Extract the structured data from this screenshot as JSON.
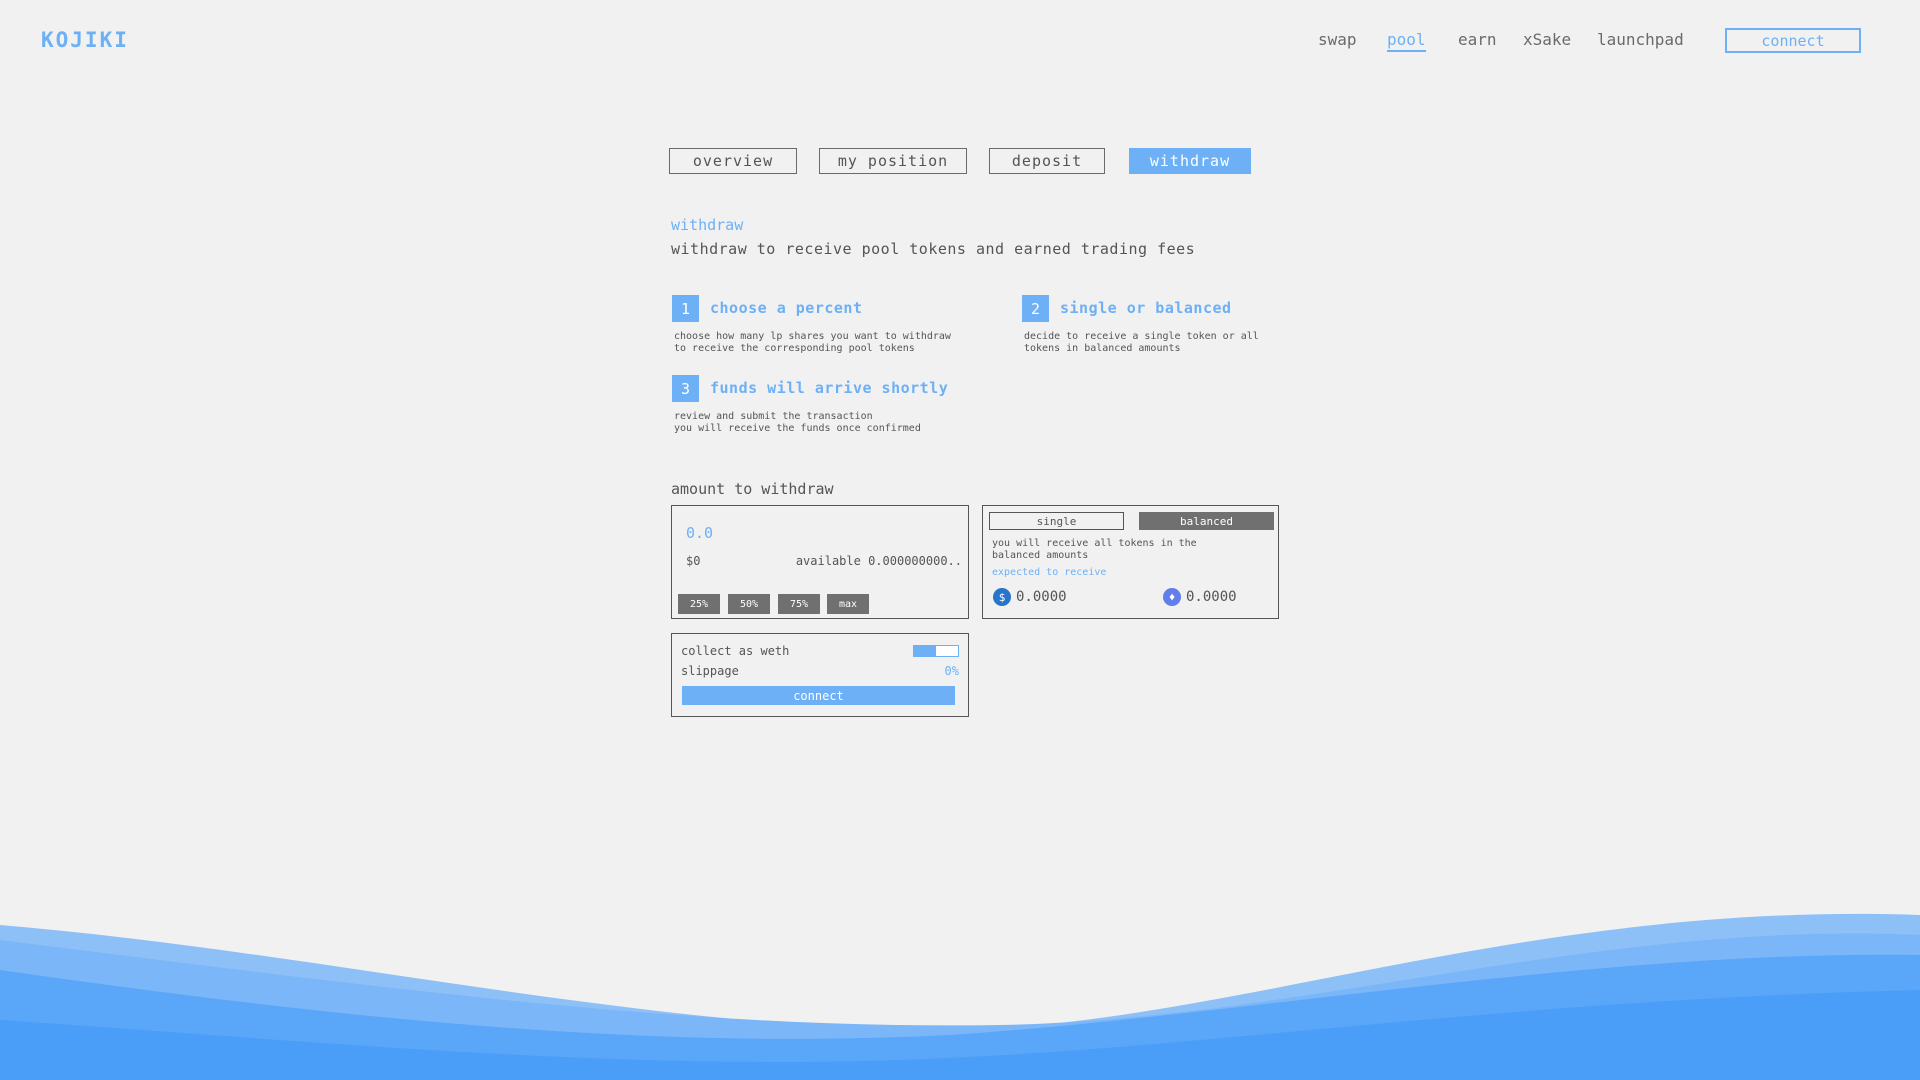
{
  "header": {
    "logo": "KOJIKI",
    "nav": [
      {
        "label": "swap",
        "active": false
      },
      {
        "label": "pool",
        "active": true
      },
      {
        "label": "earn",
        "active": false
      },
      {
        "label": "xSake",
        "active": false
      },
      {
        "label": "launchpad",
        "active": false
      }
    ],
    "connect_label": "connect"
  },
  "tabs": [
    {
      "label": "overview",
      "active": false
    },
    {
      "label": "my position",
      "active": false
    },
    {
      "label": "deposit",
      "active": false
    },
    {
      "label": "withdraw",
      "active": true
    }
  ],
  "intro": {
    "title": "withdraw",
    "subtitle": "withdraw to receive pool tokens and earned trading fees"
  },
  "steps": [
    {
      "number": "1",
      "title": "choose a percent",
      "desc": "choose how many lp shares you want to withdraw\nto receive the corresponding pool tokens"
    },
    {
      "number": "2",
      "title": "single or balanced",
      "desc": "decide to receive a single token or all\ntokens in balanced amounts"
    },
    {
      "number": "3",
      "title": "funds will arrive shortly",
      "desc": "review and submit the transaction\nyou will receive the funds once confirmed"
    }
  ],
  "amount": {
    "label": "amount to withdraw",
    "value": "0.0",
    "usd": "$0",
    "available": "available 0.000000000..",
    "percent_buttons": [
      "25%",
      "50%",
      "75%",
      "max"
    ]
  },
  "receive": {
    "single_label": "single",
    "balanced_label": "balanced",
    "selected_mode": "balanced",
    "desc": "you will receive all tokens in the balanced amounts",
    "expected_label": "expected to receive",
    "tokens": [
      {
        "icon": "usdc-icon",
        "amount": "0.0000",
        "color": "#2775ca"
      },
      {
        "icon": "eth-icon",
        "amount": "0.0000",
        "color": "#627eea"
      }
    ]
  },
  "settings": {
    "collect_label": "collect as weth",
    "collect_toggle_level": 0.5,
    "slippage_label": "slippage",
    "slippage_value": "0%",
    "connect_label": "connect"
  },
  "colors": {
    "accent": "#6eb0f5",
    "background": "#f1f1f1",
    "button_gray": "#707070"
  }
}
